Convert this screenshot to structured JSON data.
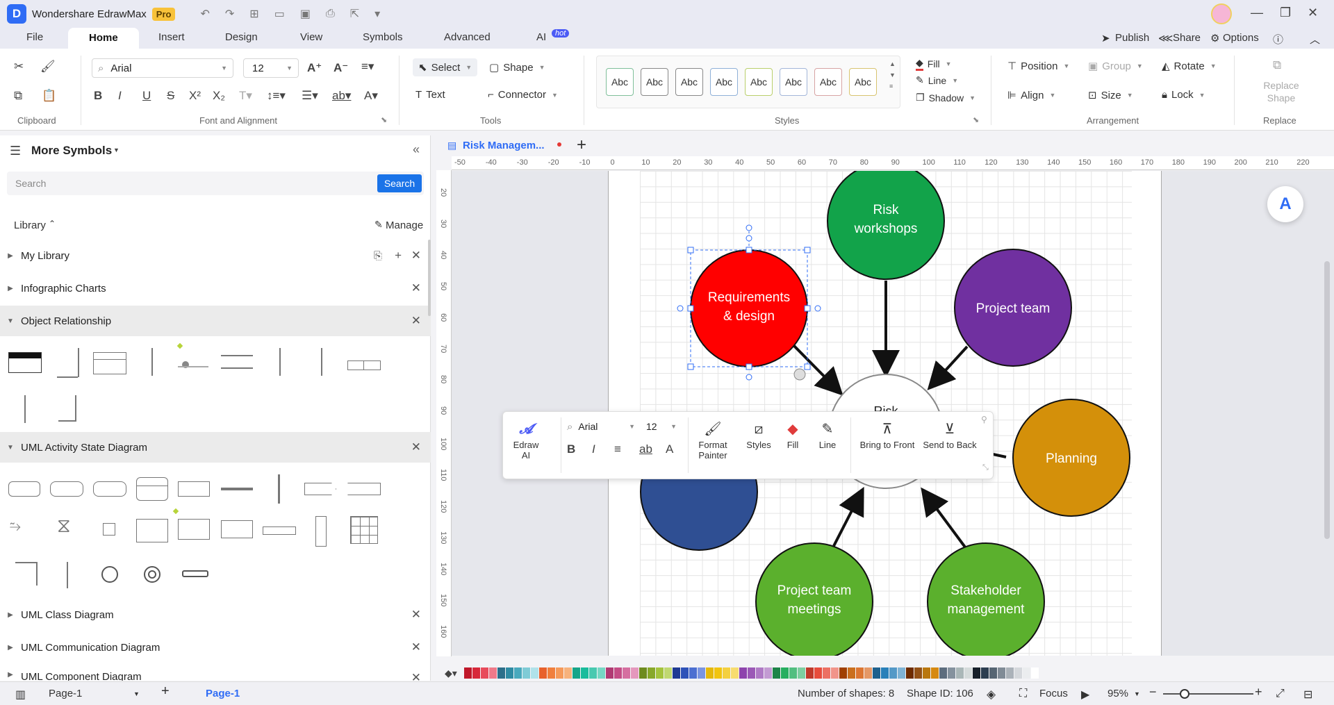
{
  "app": {
    "logo": "D",
    "title": "Wondershare EdrawMax",
    "badge": "Pro"
  },
  "menu": {
    "tabs": [
      "File",
      "Home",
      "Insert",
      "Design",
      "View",
      "Symbols",
      "Advanced",
      "AI"
    ],
    "ai_badge": "hot",
    "publish": "Publish",
    "share": "Share",
    "options": "Options"
  },
  "ribbon": {
    "clipboard_label": "Clipboard",
    "font_label": "Font and Alignment",
    "font_name": "Arial",
    "font_size": "12",
    "tools_label": "Tools",
    "select": "Select",
    "shape": "Shape",
    "text": "Text",
    "connector": "Connector",
    "styles_label": "Styles",
    "style_boxes": [
      "Abc",
      "Abc",
      "Abc",
      "Abc",
      "Abc",
      "Abc",
      "Abc",
      "Abc"
    ],
    "fill": "Fill",
    "line": "Line",
    "shadow": "Shadow",
    "arrangement_label": "Arrangement",
    "position": "Position",
    "group": "Group",
    "rotate": "Rotate",
    "align": "Align",
    "size": "Size",
    "lock": "Lock",
    "replace_shape": "Replace Shape",
    "replace_label": "Replace"
  },
  "left_panel": {
    "title": "More Symbols",
    "search_placeholder": "Search",
    "search_button": "Search",
    "library": "Library",
    "manage": "Manage",
    "sections": [
      "My Library",
      "Infographic Charts",
      "Object Relationship",
      "UML Activity State Diagram",
      "UML Class Diagram",
      "UML Communication Diagram",
      "UML Component Diagram"
    ]
  },
  "document": {
    "tab_name": "Risk Managem...",
    "h_ruler": [
      "-50",
      "-40",
      "-30",
      "-20",
      "-10",
      "0",
      "10",
      "20",
      "30",
      "40",
      "50",
      "60",
      "70",
      "80",
      "90",
      "100",
      "110",
      "120",
      "130",
      "140",
      "150",
      "160",
      "170",
      "180",
      "190",
      "200",
      "210",
      "220"
    ],
    "v_ruler": [
      "20",
      "30",
      "40",
      "50",
      "60",
      "70",
      "80",
      "90",
      "100",
      "110",
      "120",
      "130",
      "140",
      "150",
      "160"
    ]
  },
  "diagram": {
    "center": "Risk",
    "nodes": [
      {
        "line1": "Risk",
        "line2": "workshops",
        "color": "#12a34a"
      },
      {
        "line1": "Project team",
        "line2": "",
        "color": "#7030a0"
      },
      {
        "line1": "Requirements",
        "line2": "& design",
        "color": "#ff0000"
      },
      {
        "line1": "Planning",
        "line2": "",
        "color": "#d4900a"
      },
      {
        "line1": "Project team",
        "line2": "meetings",
        "color": "#5bb02d"
      },
      {
        "line1": "Stakeholder",
        "line2": "management",
        "color": "#5bb02d"
      },
      {
        "line1": "",
        "line2": "",
        "color": "#2f4f93"
      }
    ]
  },
  "floatbar": {
    "edraw_ai": "Edraw AI",
    "font": "Arial",
    "size": "12",
    "format_painter_1": "Format",
    "format_painter_2": "Painter",
    "styles": "Styles",
    "fill": "Fill",
    "line": "Line",
    "bring_front": "Bring to Front",
    "send_back": "Send to Back"
  },
  "status": {
    "page_selector": "Page-1",
    "page_tab": "Page-1",
    "shapes": "Number of shapes: 8",
    "shape_id": "Shape ID: 106",
    "focus": "Focus",
    "zoom": "95%"
  },
  "colors": {
    "accent": "#2f6cf5",
    "search_button": "#1a73e8"
  }
}
